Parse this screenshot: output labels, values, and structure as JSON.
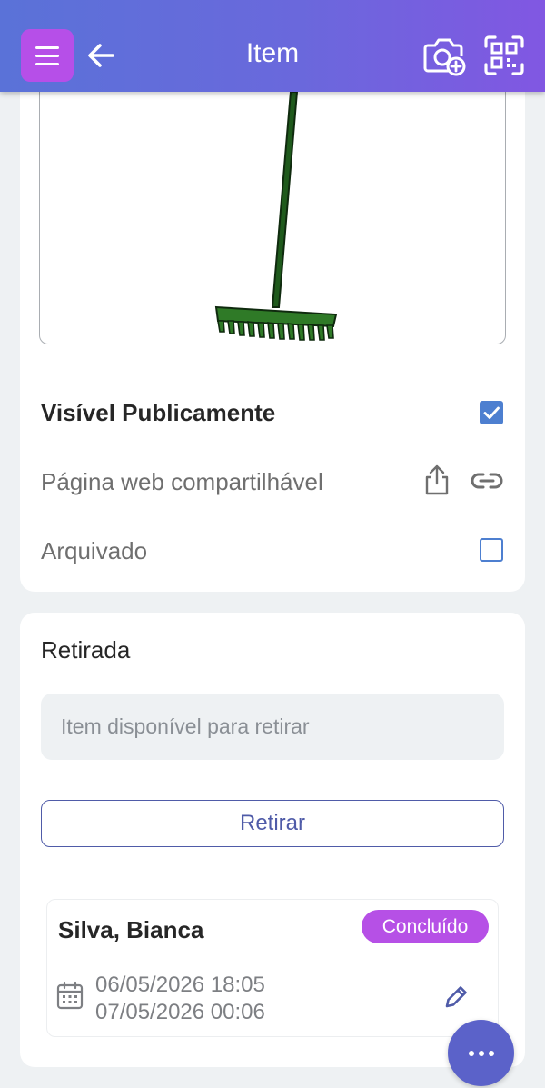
{
  "header": {
    "title": "Item",
    "icons": [
      "menu-icon",
      "back-arrow-icon",
      "camera-add-icon",
      "qr-scan-icon"
    ]
  },
  "item": {
    "image": "rake-icon",
    "visible_publicly": {
      "label": "Visível Publicamente",
      "checked": true
    },
    "shareable_page": {
      "label": "Página web compartilhável"
    },
    "archived": {
      "label": "Arquivado",
      "checked": false
    }
  },
  "checkout": {
    "title": "Retirada",
    "status_text": "Item disponível para retirar",
    "button_label": "Retirar",
    "history": [
      {
        "name": "Silva, Bianca",
        "status": "Concluído",
        "start": "06/05/2026 18:05",
        "end": "07/05/2026 00:06"
      }
    ]
  },
  "colors": {
    "header_start": "#5a72d8",
    "header_end": "#8157e2",
    "menu_button": "#b64fe8",
    "badge": "#b650e6",
    "accent": "#4d7fd0",
    "button_text": "#4f5ba8",
    "fab": "#5b62c9"
  }
}
